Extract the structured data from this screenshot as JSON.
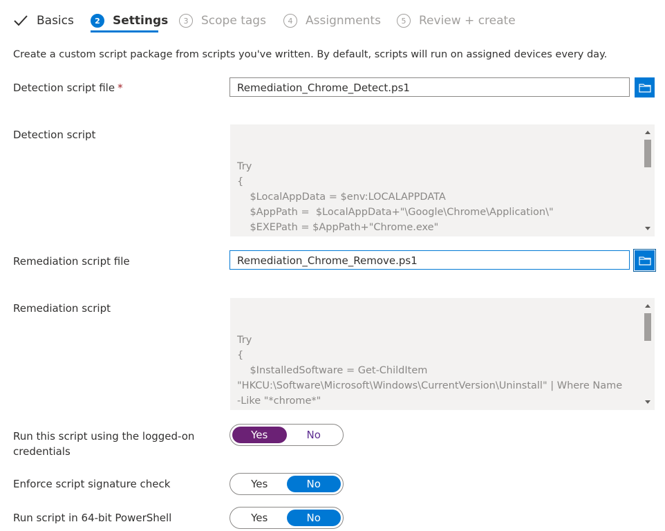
{
  "wizard": {
    "steps": [
      {
        "number": "",
        "label": "Basics",
        "state": "completed"
      },
      {
        "number": "2",
        "label": "Settings",
        "state": "active"
      },
      {
        "number": "3",
        "label": "Scope tags",
        "state": "inactive"
      },
      {
        "number": "4",
        "label": "Assignments",
        "state": "inactive"
      },
      {
        "number": "5",
        "label": "Review + create",
        "state": "inactive"
      }
    ]
  },
  "description": "Create a custom script package from scripts you've written. By default, scripts will run on assigned devices every day.",
  "detection_file": {
    "label": "Detection script file",
    "required_marker": "*",
    "value": "Remediation_Chrome_Detect.ps1"
  },
  "detection_script": {
    "label": "Detection script",
    "content": "Try\n{\n    $LocalAppData = $env:LOCALAPPDATA\n    $AppPath =  $LocalAppData+\"\\Google\\Chrome\\Application\\\"\n    $EXEPath = $AppPath+\"Chrome.exe\"\n\n    If ($(Test-Path -Path $EXEPath) -eq $True) {"
  },
  "remediation_file": {
    "label": "Remediation script file",
    "value": "Remediation_Chrome_Remove.ps1"
  },
  "remediation_script": {
    "label": "Remediation script",
    "content": "Try\n{\n    $InstalledSoftware = Get-ChildItem\n\"HKCU:\\Software\\Microsoft\\Windows\\CurrentVersion\\Uninstall\" | Where Name\n-Like \"*chrome*\"\n    $TmpPath = $InstalledSoftware.GetValue('UninstallString')"
  },
  "toggles": {
    "logged_on": {
      "label": "Run this script using the logged-on credentials",
      "yes": "Yes",
      "no": "No",
      "selected": "Yes"
    },
    "signature": {
      "label": "Enforce script signature check",
      "yes": "Yes",
      "no": "No",
      "selected": "No"
    },
    "powershell64": {
      "label": "Run script in 64-bit PowerShell",
      "yes": "Yes",
      "no": "No",
      "selected": "No"
    }
  },
  "icons": {
    "completed_step": "checkmark-icon",
    "browse": "folder-icon"
  },
  "colors": {
    "accent": "#0078d4",
    "toggle_selected_purple": "#6b2175",
    "required": "#a4262c",
    "disabled_text": "#a19f9d"
  }
}
